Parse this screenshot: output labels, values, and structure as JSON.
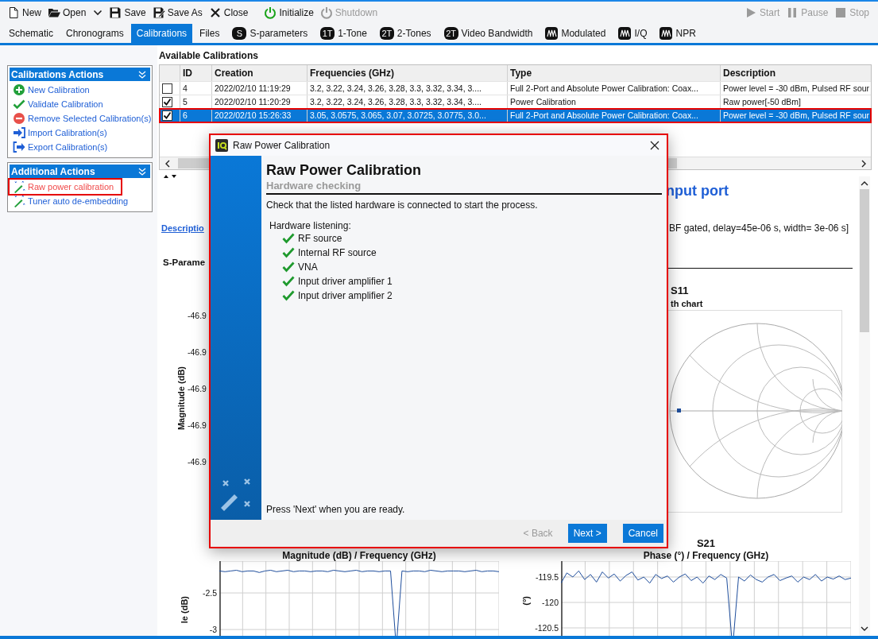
{
  "toolbar": {
    "left": [
      {
        "label": "New",
        "kind": "new",
        "disabled": false
      },
      {
        "label": "Open",
        "kind": "open",
        "disabled": false,
        "dropdown": true
      },
      {
        "label": "Save",
        "kind": "save",
        "disabled": false
      },
      {
        "label": "Save As",
        "kind": "save_as",
        "disabled": false
      },
      {
        "label": "Close",
        "kind": "close",
        "disabled": false
      },
      {
        "label": "Initialize",
        "kind": "initialize",
        "disabled": false
      },
      {
        "label": "Shutdown",
        "kind": "shutdown",
        "disabled": true
      }
    ],
    "right": [
      {
        "label": "Start",
        "kind": "start",
        "disabled": true
      },
      {
        "label": "Pause",
        "kind": "pause",
        "disabled": true
      },
      {
        "label": "Stop",
        "kind": "stop",
        "disabled": true
      }
    ]
  },
  "tabs": [
    {
      "label": "Schematic",
      "kind": "plain",
      "selected": false
    },
    {
      "label": "Chronograms",
      "kind": "plain",
      "selected": false
    },
    {
      "label": "Calibrations",
      "kind": "plain",
      "selected": true
    },
    {
      "label": "Files",
      "kind": "plain",
      "selected": false
    },
    {
      "label": "S-parameters",
      "kind": "badge",
      "badge": "S",
      "selected": false
    },
    {
      "label": "1-Tone",
      "kind": "badge",
      "badge": "1T",
      "selected": false
    },
    {
      "label": "2-Tones",
      "kind": "badge",
      "badge": "2T",
      "selected": false
    },
    {
      "label": "Video Bandwidth",
      "kind": "badge",
      "badge": "2T",
      "selected": false
    },
    {
      "label": "Modulated",
      "kind": "wave",
      "selected": false
    },
    {
      "label": "I/Q",
      "kind": "wave",
      "selected": false
    },
    {
      "label": "NPR",
      "kind": "wave",
      "selected": false
    }
  ],
  "sidebar": {
    "panels": [
      {
        "title": "Calibrations Actions",
        "items": [
          {
            "label": "New Calibration",
            "kind": "add",
            "highlighted": false
          },
          {
            "label": "Validate Calibration",
            "kind": "validate",
            "highlighted": false
          },
          {
            "label": "Remove Selected Calibration(s)",
            "kind": "remove",
            "highlighted": false
          },
          {
            "label": "Import Calibration(s)",
            "kind": "import",
            "highlighted": false
          },
          {
            "label": "Export Calibration(s)",
            "kind": "export",
            "highlighted": false
          }
        ]
      },
      {
        "title": "Additional Actions",
        "items": [
          {
            "label": "Raw power calibration",
            "kind": "wand",
            "highlighted": true
          },
          {
            "label": "Tuner auto de-embedding",
            "kind": "wand",
            "highlighted": false
          }
        ]
      }
    ]
  },
  "table": {
    "title": "Available Calibrations",
    "columns": [
      "ID",
      "Creation",
      "Frequencies (GHz)",
      "Type",
      "Description"
    ],
    "rows": [
      {
        "checked": false,
        "selected": false,
        "highlighted": false,
        "cells": [
          "4",
          "2022/02/10 11:19:29",
          "3.2, 3.22, 3.24, 3.26, 3.28, 3.3, 3.32, 3.34, 3....",
          "Full 2-Port and Absolute Power Calibration: Coax...",
          "Power level = -30 dBm, Pulsed RF sour"
        ]
      },
      {
        "checked": true,
        "selected": false,
        "highlighted": false,
        "cells": [
          "5",
          "2022/02/10 11:20:29",
          "3.2, 3.22, 3.24, 3.26, 3.28, 3.3, 3.32, 3.34, 3....",
          "Power Calibration",
          "Raw power[-50 dBm]"
        ]
      },
      {
        "checked": true,
        "selected": true,
        "highlighted": true,
        "cells": [
          "6",
          "2022/02/10 15:26:33",
          "3.05, 3.0575, 3.065, 3.07, 3.0725, 3.0775, 3.0...",
          "Full 2-Port and Absolute Power Calibration: Coax...",
          "Power level = -30 dBm, Pulsed RF sour"
        ]
      }
    ]
  },
  "details": {
    "title": "nput port",
    "link": "Descriptio",
    "description": "BF gated, delay=45e-06 s, width= 3e-06 s]",
    "section": "S-Parame",
    "s11": {
      "title": "S11",
      "subtitle": "th chart",
      "ylabel": "Magnitude (dB)",
      "yticks": [
        "-46.9",
        "-46.9",
        "-46.9",
        "-46.9",
        "-46.9"
      ]
    },
    "s21": {
      "title": "S21",
      "charts": [
        {
          "chart_data": {
            "type": "line",
            "title": "Magnitude (dB) / Frequency (GHz)",
            "ylabel": "le (dB)",
            "grid": true,
            "ylim": [
              -3.26,
              -2.065
            ],
            "yticks": [
              {
                "value": -2.5,
                "label": "-2.5"
              },
              {
                "value": -3,
                "label": "-3"
              }
            ],
            "series": [
              {
                "color": "#1f4e9c",
                "values": [
                  -2.2,
                  -2.21,
                  -2.2,
                  -2.19,
                  -2.21,
                  -2.2,
                  -2.2,
                  -2.22,
                  -2.2,
                  -2.19,
                  -2.21,
                  -2.2,
                  -2.19,
                  -2.21,
                  -2.2,
                  -2.2,
                  -2.21,
                  -2.2,
                  -2.2,
                  -2.21,
                  -2.19,
                  -2.2,
                  -2.21,
                  -2.2,
                  -2.19,
                  -2.21,
                  -2.2,
                  -2.2,
                  -2.21,
                  -2.2,
                  -2.2,
                  -3.25,
                  -2.2,
                  -2.21,
                  -2.2,
                  -2.2,
                  -2.21,
                  -2.19,
                  -2.2,
                  -2.21,
                  -2.2,
                  -2.2,
                  -2.2,
                  -2.21,
                  -2.2,
                  -2.19,
                  -2.21,
                  -2.2,
                  -2.2,
                  -2.21
                ]
              }
            ]
          }
        },
        {
          "chart_data": {
            "type": "line",
            "title": "Phase (°) / Frequency (GHz)",
            "ylabel": "(°)",
            "grid": true,
            "ylim": [
              -120.906,
              -119.1875
            ],
            "yticks": [
              {
                "value": -119.5,
                "label": "-119.5"
              },
              {
                "value": -120,
                "label": "-120"
              },
              {
                "value": -120.5,
                "label": "-120.5"
              }
            ],
            "series": [
              {
                "color": "#1f4e9c",
                "values": [
                  -119.62,
                  -119.42,
                  -119.5,
                  -119.38,
                  -119.55,
                  -119.45,
                  -119.6,
                  -119.4,
                  -119.52,
                  -119.44,
                  -119.58,
                  -119.47,
                  -119.4,
                  -119.56,
                  -119.5,
                  -119.62,
                  -119.45,
                  -119.53,
                  -119.48,
                  -119.6,
                  -119.5,
                  -119.44,
                  -119.57,
                  -119.5,
                  -119.62,
                  -119.48,
                  -119.55,
                  -119.45,
                  -119.52,
                  -120.9,
                  -119.5,
                  -119.58,
                  -119.46,
                  -119.55,
                  -119.6,
                  -119.5,
                  -119.45,
                  -119.57,
                  -119.52,
                  -119.48,
                  -119.6,
                  -119.5,
                  -119.55,
                  -119.45,
                  -119.58,
                  -119.5,
                  -119.54,
                  -119.48,
                  -119.55,
                  -119.52
                ]
              }
            ]
          }
        }
      ]
    }
  },
  "dialog": {
    "title": "Raw Power Calibration",
    "annotated": true,
    "heading": "Raw Power Calibration",
    "subheading": "Hardware checking",
    "instruction": "Check that the listed hardware is connected to start the process.",
    "list_label": "Hardware listening:",
    "hardware": [
      {
        "name": "RF source",
        "connected": true
      },
      {
        "name": "Internal RF source",
        "connected": true
      },
      {
        "name": "VNA",
        "connected": true
      },
      {
        "name": "Input driver amplifier 1",
        "connected": true
      },
      {
        "name": "Input driver amplifier 2",
        "connected": true
      }
    ],
    "footer_note": "Press 'Next' when you are ready.",
    "buttons": [
      {
        "label": "< Back",
        "kind": "back",
        "disabled": true
      },
      {
        "label": "Next >",
        "kind": "next",
        "disabled": false
      },
      {
        "label": "Cancel",
        "kind": "cancel",
        "disabled": false
      }
    ]
  }
}
